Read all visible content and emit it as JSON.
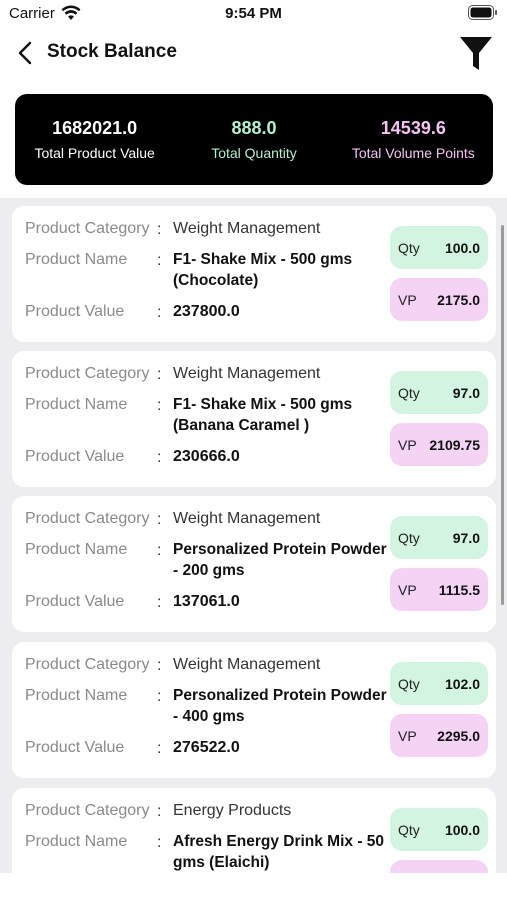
{
  "status_bar": {
    "carrier": "Carrier",
    "time": "9:54 PM"
  },
  "nav": {
    "title": "Stock Balance",
    "back_icon": "chevron-left-icon",
    "filter_icon": "filter-funnel-icon"
  },
  "summary": {
    "total_product_value": "1682021.0",
    "total_product_value_label": "Total Product Value",
    "total_quantity": "888.0",
    "total_quantity_label": "Total Quantity",
    "total_volume_points": "14539.6",
    "total_volume_points_label": "Total Volume Points"
  },
  "labels": {
    "product_category": "Product Category",
    "product_name": "Product Name",
    "product_value": "Product Value",
    "colon": ":",
    "qty": "Qty",
    "vp": "VP"
  },
  "products": [
    {
      "category": "Weight Management",
      "name": "F1-  Shake Mix - 500 gms (Chocolate)",
      "value": "237800.0",
      "qty": "100.0",
      "vp": "2175.0"
    },
    {
      "category": "Weight Management",
      "name": "F1-  Shake Mix - 500 gms (Banana Caramel  )",
      "value": "230666.0",
      "qty": "97.0",
      "vp": "2109.75"
    },
    {
      "category": "Weight Management",
      "name": "Personalized Protein Powder - 200 gms",
      "value": "137061.0",
      "qty": "97.0",
      "vp": "1115.5"
    },
    {
      "category": "Weight Management",
      "name": "Personalized Protein Powder - 400 gms",
      "value": "276522.0",
      "qty": "102.0",
      "vp": "2295.0"
    },
    {
      "category": "Energy Products",
      "name": "Afresh Energy Drink Mix - 50 gms (Elaichi)",
      "value": "",
      "qty": "100.0",
      "vp": ""
    }
  ],
  "colors": {
    "summary_bg": "#000000",
    "qty_pill": "#d3f4e1",
    "vp_pill": "#f4d3f4",
    "total_quantity_text": "#b4f0cf",
    "total_vp_text": "#f3c4f3",
    "list_bg": "#ededf0"
  }
}
